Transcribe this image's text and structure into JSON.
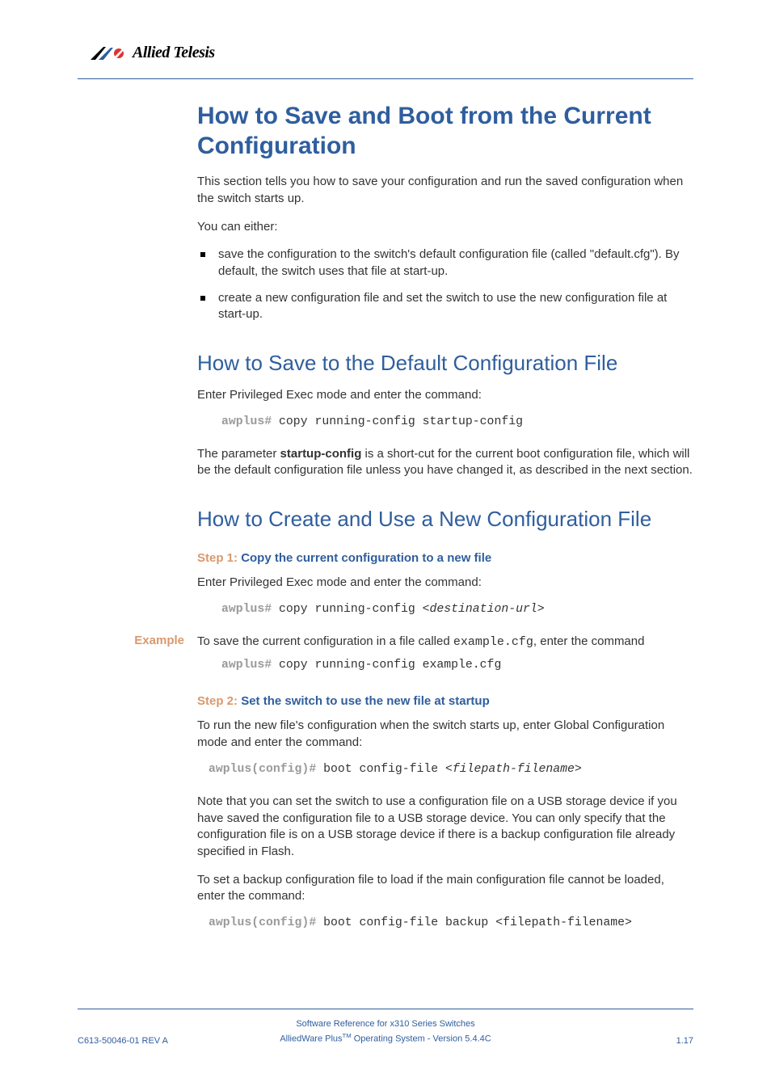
{
  "brand": {
    "name": "Allied Telesis"
  },
  "h1": "How to Save and Boot from the Current Configuration",
  "intro": {
    "p1": "This section tells you how to save your configuration and run the saved configuration when the switch starts up.",
    "p2": "You can either:"
  },
  "bullets": {
    "b1": "save the configuration to the switch's default configuration file (called \"default.cfg\"). By default, the switch uses that file at start-up.",
    "b2": "create a new configuration file and set the switch to use the new configuration file at start-up."
  },
  "h2a": "How to Save to the Default Configuration File",
  "sectA": {
    "p1": "Enter Privileged Exec mode and enter the command:",
    "prompt1": "awplus#",
    "cmd1": " copy running-config startup-config",
    "p2_a": "The parameter ",
    "p2_b": "startup-config",
    "p2_c": " is a short-cut for the current boot configuration file, which will be the default configuration file unless you have changed it, as described in the next section."
  },
  "h2b": "How to Create and Use a New Configuration File",
  "step1": {
    "label": "Step 1: ",
    "title": "Copy the current configuration to a new file",
    "p1": "Enter Privileged Exec mode and enter the command:",
    "prompt1": "awplus#",
    "cmd1a": " copy running-config <",
    "cmd1b": "destination-url",
    "cmd1c": ">",
    "exampleLabel": "Example",
    "p2_a": "To save the current configuration in a file called ",
    "p2_b": "example.cfg",
    "p2_c": ", enter the command",
    "prompt2": "awplus#",
    "cmd2": " copy running-config example.cfg"
  },
  "step2": {
    "label": "Step 2: ",
    "title": "Set the switch to use the new file at startup",
    "p1": "To run the new file's configuration when the switch starts up, enter Global Configuration mode and enter the command:",
    "prompt1": "awplus(config)#",
    "cmd1a": " boot config-file <",
    "cmd1b": "filepath-filename",
    "cmd1c": ">",
    "p2": "Note that you can set the switch to use a configuration file on a USB storage device if you have saved the configuration file to a USB storage device. You can only specify that the configuration file is on a USB storage device if there is a backup configuration file already specified in Flash.",
    "p3": "To set a backup configuration file to load if the main configuration file cannot be loaded, enter the command:",
    "prompt2": "awplus(config)#",
    "cmd2": " boot config-file backup <filepath-filename>"
  },
  "footer": {
    "left": "C613-50046-01 REV A",
    "center1": "Software Reference for x310 Series Switches",
    "center2a": "AlliedWare Plus",
    "center2b": " Operating System - Version 5.4.4C",
    "right": "1.17"
  }
}
